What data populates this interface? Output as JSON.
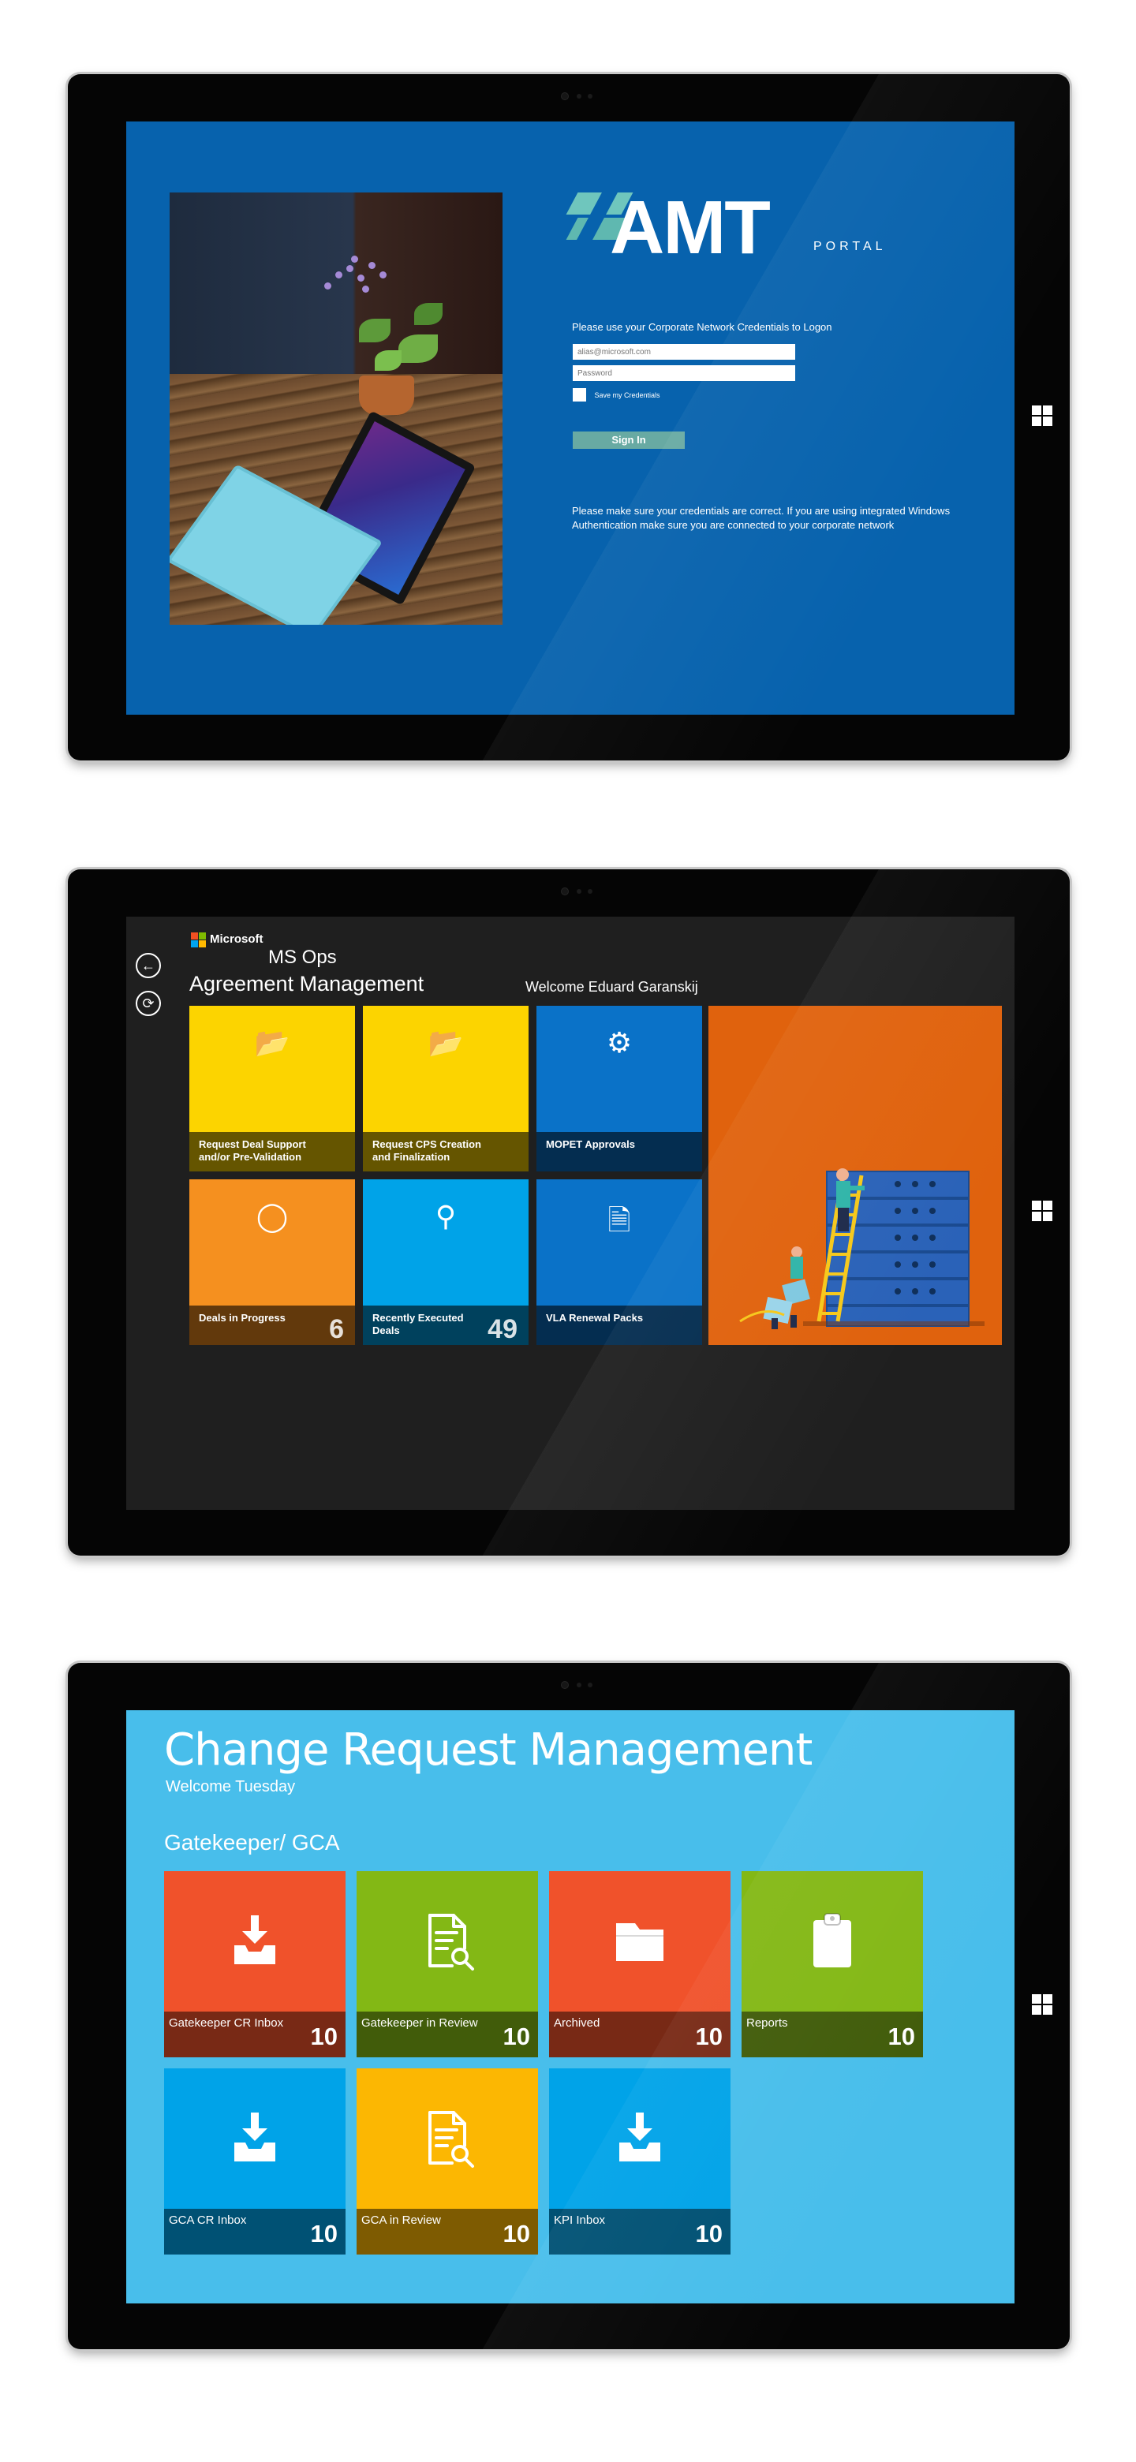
{
  "login": {
    "logo_text": "AMT",
    "logo_subtitle": "PORTAL",
    "prompt": "Please use your Corporate Network Credentials to Logon",
    "email_placeholder": "alias@microsoft.com",
    "password_placeholder": "Password",
    "save_credentials_label": "Save my Credentials",
    "sign_in_label": "Sign In",
    "note": "Please make sure your credentials are correct. If you are using integrated Windows Authentication make sure you are connected to your corporate network"
  },
  "msops": {
    "brand": "Microsoft",
    "app_name": "MS Ops",
    "title": "Agreement Management",
    "welcome": "Welcome Eduard Garanskij",
    "tiles": [
      {
        "label": "Request Deal Support and/or Pre-Validation",
        "count": "",
        "color": "#fcd400",
        "icon": "document-lock-icon"
      },
      {
        "label": "Request CPS Creation and Finalization",
        "count": "",
        "color": "#fcd400",
        "icon": "document-lock-icon"
      },
      {
        "label": "MOPET Approvals",
        "count": "",
        "color": "#0a72c8",
        "icon": "gears-icon"
      },
      {
        "label": "Deals in Progress",
        "count": "6",
        "color": "#f5901f",
        "icon": "spinner-icon"
      },
      {
        "label": "Recently Executed Deals",
        "count": "49",
        "color": "#00a3e8",
        "icon": "tag-icon"
      },
      {
        "label": "VLA Renewal Packs",
        "count": "",
        "color": "#0a72c8",
        "icon": "document-stack-icon"
      }
    ],
    "hero_color": "#e0620d"
  },
  "crm": {
    "title": "Change Request Management",
    "welcome": "Welcome Tuesday",
    "section": "Gatekeeper/ GCA",
    "tiles": [
      {
        "label": "Gatekeeper CR Inbox",
        "count": "10",
        "color": "#f0522b",
        "icon": "inbox-download-icon"
      },
      {
        "label": "Gatekeeper in Review",
        "count": "10",
        "color": "#83b815",
        "icon": "document-search-icon"
      },
      {
        "label": "Archived",
        "count": "10",
        "color": "#f0522b",
        "icon": "folder-icon"
      },
      {
        "label": "Reports",
        "count": "10",
        "color": "#83b815",
        "icon": "clipboard-icon"
      },
      {
        "label": "GCA CR Inbox",
        "count": "10",
        "color": "#00a3e8",
        "icon": "inbox-download-icon"
      },
      {
        "label": "GCA in Review",
        "count": "10",
        "color": "#fcb702",
        "icon": "document-search-icon"
      },
      {
        "label": "KPI Inbox",
        "count": "10",
        "color": "#00a3e8",
        "icon": "inbox-download-icon"
      }
    ]
  }
}
